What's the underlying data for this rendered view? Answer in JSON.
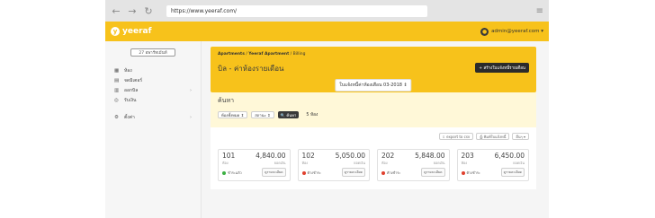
{
  "browser": {
    "url": "https://www.yeeraf.com/",
    "back": "←",
    "forward": "→",
    "reload": "↻",
    "menu": "≡"
  },
  "topbar": {
    "brand": "yeeraf",
    "logo_glyph": "y",
    "user_email": "admin@yeeraf.com ▾",
    "avatar_glyph": "●"
  },
  "sidebar": {
    "button": "27 อพาร์ทเม้นท์",
    "items": [
      {
        "label": "ห้อง",
        "icon": "▦"
      },
      {
        "label": "จดมิเตอร์",
        "icon": "▤"
      },
      {
        "label": "ออกบิล",
        "icon": "▥",
        "chevron": "›"
      },
      {
        "label": "รับเงิน",
        "icon": "◎"
      },
      {
        "label": "ตั้งค่า",
        "icon": "⚙",
        "chevron": "›"
      }
    ]
  },
  "header": {
    "breadcrumb_1": "Apartments",
    "breadcrumb_2": "Yeeraf Apartment",
    "breadcrumb_3": "Billing",
    "separator": "/",
    "title": "บิล - ค่าห้องรายเดือน",
    "create_button": "+ สร้างใบแจ้งหนี้รายเดือน",
    "period": "ใบแจ้งหนี้ค่าห้องเดือน 03-2018 ⇕"
  },
  "search": {
    "title": "ค้นหา",
    "select_1": "ห้องทั้งหมด ⇕",
    "select_2": "สถานะ ⇕",
    "search_button": "🔍 ค้นหา",
    "result": "5 ห้อง"
  },
  "actions": {
    "export": "⇩ export to csv",
    "print": "⎙ พิมพ์ใบแจ้งหนี้",
    "more": "อื่นๆ ▾"
  },
  "rooms": [
    {
      "number": "101",
      "amount": "4,840.00",
      "sub_left": "ห้อง",
      "sub_right": "ยอดเงิน",
      "status": "ชำระแล้ว",
      "status_color": "#3cb043",
      "detail": "ดูรายละเอียด"
    },
    {
      "number": "102",
      "amount": "5,050.00",
      "sub_left": "ห้อง",
      "sub_right": "ยอดเงิน",
      "status": "ค้างชำระ",
      "status_color": "#e0402e",
      "detail": "ดูรายละเอียด"
    },
    {
      "number": "202",
      "amount": "5,848.00",
      "sub_left": "ห้อง",
      "sub_right": "ยอดเงิน",
      "status": "ค้างชำระ",
      "status_color": "#e0402e",
      "detail": "ดูรายละเอียด"
    },
    {
      "number": "203",
      "amount": "6,450.00",
      "sub_left": "ห้อง",
      "sub_right": "ยอดเงิน",
      "status": "ค้างชำระ",
      "status_color": "#e0402e",
      "detail": "ดูรายละเอียด"
    }
  ]
}
